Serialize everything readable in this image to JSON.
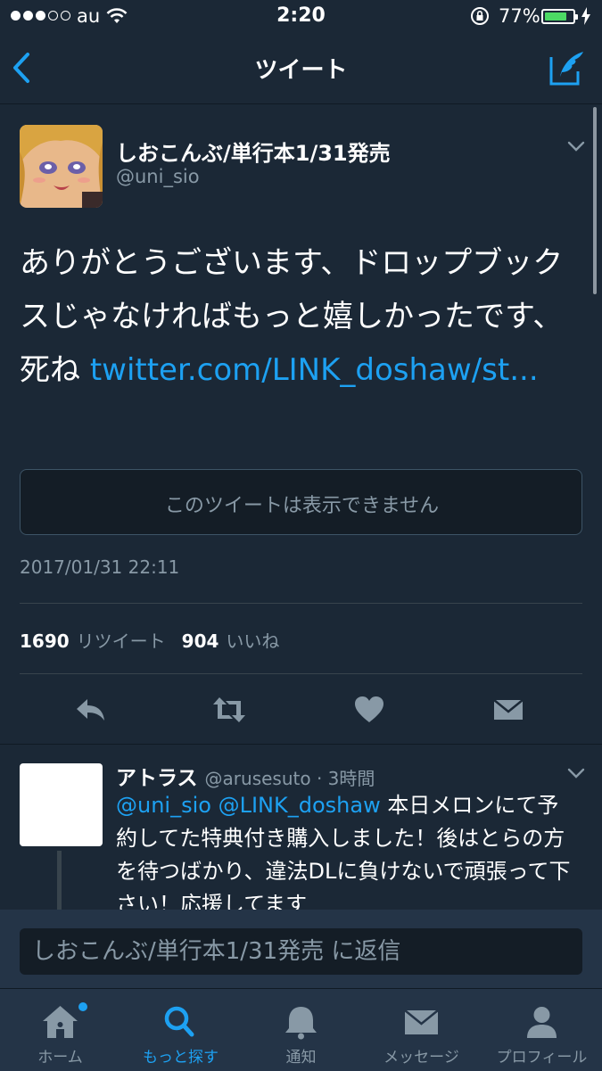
{
  "status_bar": {
    "carrier": "au",
    "time": "2:20",
    "battery_percent": "77%",
    "battery_level": 0.77,
    "signal_bars_filled": 3,
    "signal_bars_total": 5
  },
  "nav": {
    "title": "ツイート",
    "back_icon": "chevron-left-icon",
    "compose_icon": "compose-tweet-icon"
  },
  "tweet": {
    "display_name": "しおこんぶ/単行本1/31発売",
    "handle": "@uni_sio",
    "text_plain": "ありがとうございます、ドロップブックスじゃなければもっと嬉しかったです、死ね ",
    "text_link": "twitter.com/LINK_doshaw/st...",
    "quoted_unavailable": "このツイートは表示できません",
    "datetime": "2017/01/31 22:11",
    "retweet_count": "1690",
    "retweet_label": "リツイート",
    "like_count": "904",
    "like_label": "いいね"
  },
  "reply": {
    "display_name": "アトラス",
    "meta": "@arusesuto · 3時間",
    "mention1": "@uni_sio",
    "mention2": "@LINK_doshaw",
    "text": " 本日メロンにて予約してた特典付き購入しました！後はとらの方を待つばかり、違法DLに負けないで頑張って下さい！応援してます"
  },
  "composer": {
    "placeholder": "しおこんぶ/単行本1/31発売 に返信"
  },
  "tabs": [
    {
      "label": "ホーム",
      "icon": "home-icon",
      "active": false
    },
    {
      "label": "もっと探す",
      "icon": "search-icon",
      "active": true
    },
    {
      "label": "通知",
      "icon": "bell-icon",
      "active": false
    },
    {
      "label": "メッセージ",
      "icon": "envelope-icon",
      "active": false
    },
    {
      "label": "プロフィール",
      "icon": "profile-icon",
      "active": false
    }
  ],
  "colors": {
    "background": "#1b2836",
    "accent": "#1da1f2",
    "secondary_text": "#8899a6",
    "bar_background": "#243447"
  }
}
